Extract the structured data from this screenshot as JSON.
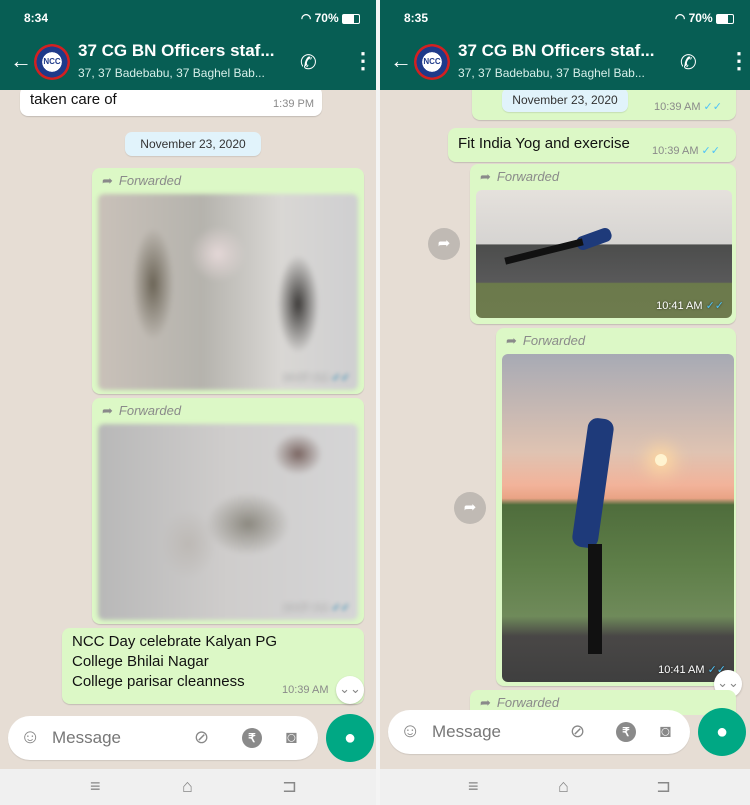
{
  "left": {
    "status": {
      "time": "8:34",
      "battery": "70%"
    },
    "header": {
      "title": "37 CG BN Officers staf...",
      "subtitle": "37, 37 Badebabu, 37 Baghel Bab...",
      "avatar_text": "NCC"
    },
    "messages": {
      "incoming_text": "taken care of",
      "incoming_time": "1:39 PM",
      "date": "November 23, 2020",
      "forwarded_label": "Forwarded",
      "photo1_time": "10:37 AM",
      "photo2_time": "10:37 AM",
      "text_lines": [
        "NCC Day celebrate Kalyan PG",
        "College Bhilai Nagar",
        "College parisar cleanness"
      ],
      "text_time": "10:39 AM"
    },
    "input": {
      "placeholder": "Message"
    }
  },
  "right": {
    "status": {
      "time": "8:35",
      "battery": "70%"
    },
    "header": {
      "title": "37 CG BN Officers staf...",
      "subtitle": "37, 37 Badebabu, 37 Baghel Bab...",
      "avatar_text": "NCC"
    },
    "messages": {
      "date": "November 23, 2020",
      "date_time": "10:39 AM",
      "text": "Fit India Yog and exercise",
      "text_time": "10:39 AM",
      "forwarded_label": "Forwarded",
      "photo1_time": "10:41 AM",
      "photo2_time": "10:41 AM",
      "forwarded_label_bottom": "Forwarded"
    },
    "input": {
      "placeholder": "Message"
    }
  },
  "colors": {
    "header": "#075e54",
    "outgoing": "#dcf8c6",
    "accent": "#00a884",
    "read_ticks": "#4fc3f7"
  },
  "icons": [
    "back-arrow-icon",
    "add-call-icon",
    "more-menu-icon",
    "forward-arrow-icon",
    "share-icon",
    "emoji-icon",
    "attach-icon",
    "rupee-icon",
    "camera-icon",
    "mic-icon",
    "chevron-down-icon",
    "nav-menu-icon",
    "nav-home-icon",
    "nav-back-icon"
  ]
}
